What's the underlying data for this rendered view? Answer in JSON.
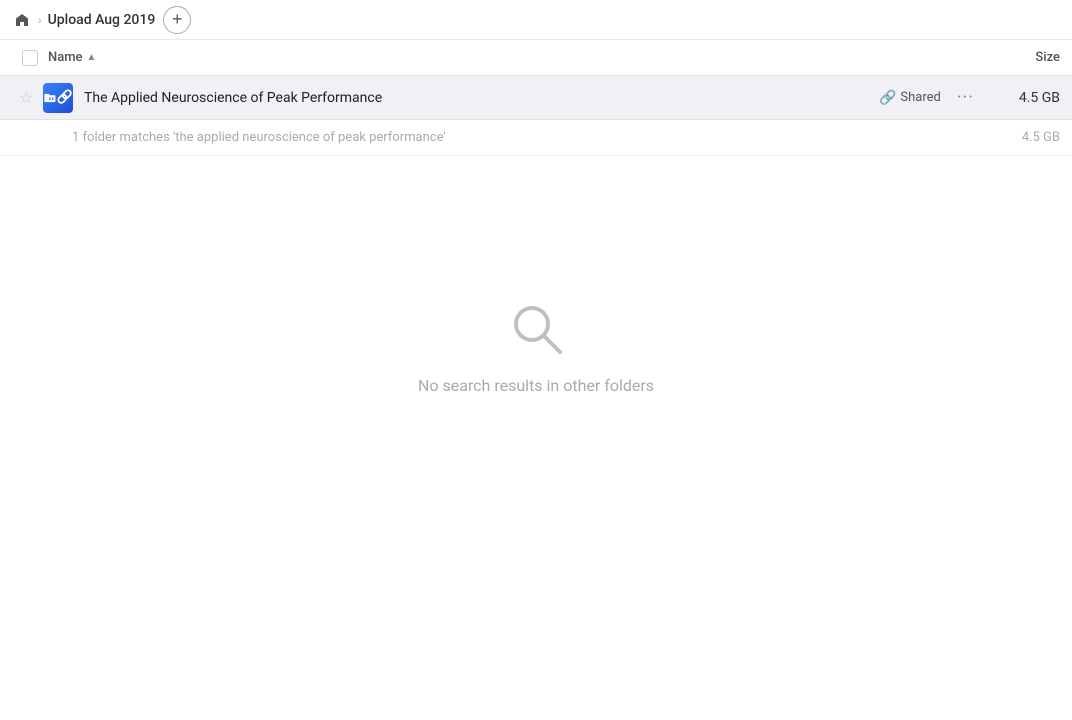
{
  "topbar": {
    "home_icon": "🏠",
    "breadcrumb_item": "Upload Aug 2019",
    "add_button_label": "+"
  },
  "column_headers": {
    "name_label": "Name",
    "size_label": "Size"
  },
  "file_row": {
    "file_name": "The Applied Neuroscience of Peak Performance",
    "shared_label": "Shared",
    "more_options": "···",
    "file_size": "4.5 GB"
  },
  "match_row": {
    "match_text": "1 folder matches 'the applied neuroscience of peak performance'",
    "match_size": "4.5 GB"
  },
  "empty_state": {
    "message": "No search results in other folders"
  }
}
